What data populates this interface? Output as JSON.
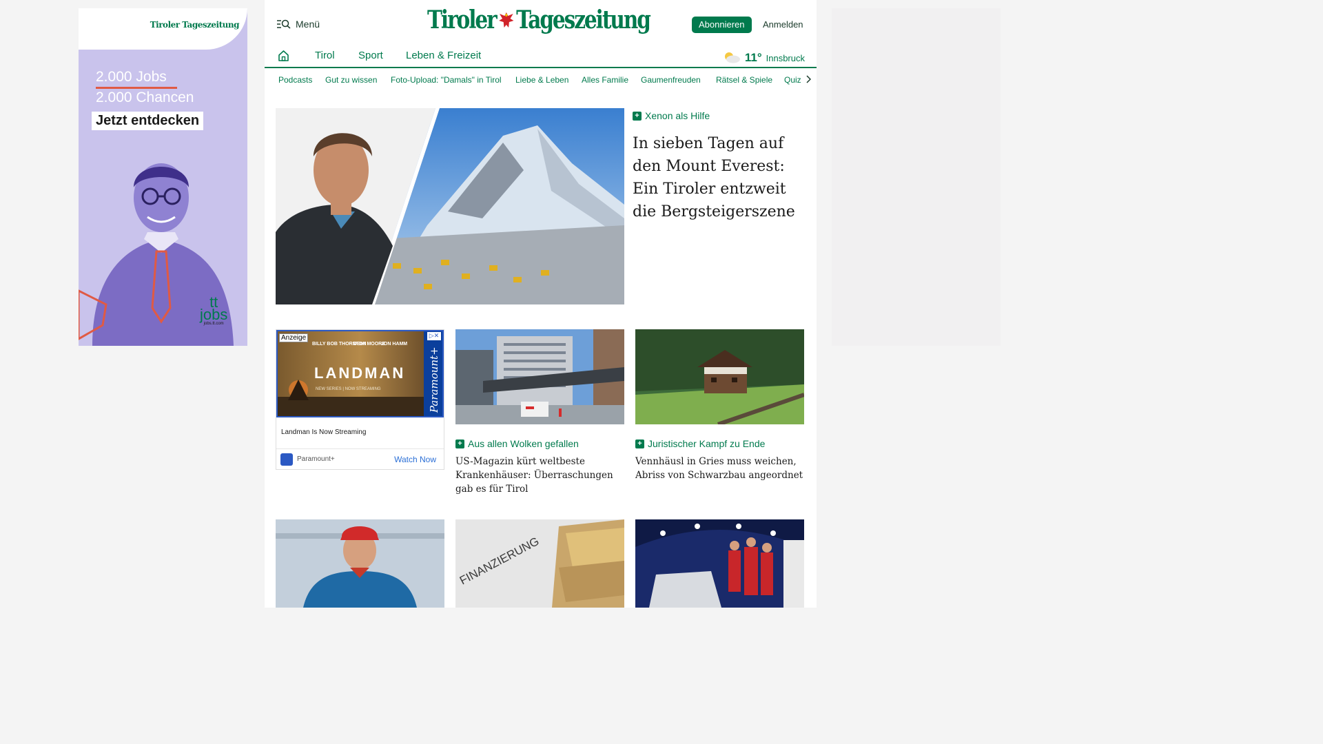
{
  "ad_left": {
    "brand": "Tiroler Tageszeitung",
    "line1": "2.000 Jobs",
    "line2": "2.000 Chancen",
    "cta": "Jetzt entdecken",
    "logo_text": "tt",
    "logo_sub": "jobs",
    "logo_url": "jobs.tt.com"
  },
  "header": {
    "menu_label": "Menü",
    "logo_left": "Tiroler",
    "logo_right": "Tageszeitung",
    "subscribe_label": "Abonnieren",
    "login_label": "Anmelden"
  },
  "nav": {
    "items": [
      "Tirol",
      "Sport",
      "Leben & Freizeit"
    ],
    "weather": {
      "temp": "11°",
      "city": "Innsbruck",
      "icon": "partly-cloudy-icon"
    }
  },
  "subnav": {
    "items": [
      "Podcasts",
      "Gut zu wissen",
      "Foto-Upload: \"Damals\" in Tirol",
      "Liebe & Leben",
      "Alles Familie",
      "Gaumenfreuden",
      "Rätsel & Spiele",
      "Quiz"
    ]
  },
  "hero": {
    "kicker": "Xenon als Hilfe",
    "title": "In sieben Tagen auf den Mount Everest: Ein Tiroler entzweit die Bergsteigerszene"
  },
  "ad_card": {
    "tag": "Anzeige",
    "cast": [
      "BILLY BOB THORNTON",
      "DEMI MOORE",
      "JON HAMM"
    ],
    "show": "LANDMAN",
    "subline": "NEW SERIES | NOW STREAMING",
    "network": "Paramount+",
    "headline": "Landman Is Now Streaming",
    "source": "Paramount+",
    "cta": "Watch Now"
  },
  "cards": [
    {
      "kicker": "Aus allen Wolken gefallen",
      "title": "US-Magazin kürt weltbeste Krankenhäuser: Überraschungen gab es für Tirol"
    },
    {
      "kicker": "Juristischer Kampf zu Ende",
      "title": "Vennhäusl in Gries muss weichen, Abriss von Schwarzbau angeordnet"
    }
  ],
  "bottom": {
    "finance_word": "FINANZIERUNG"
  },
  "colors": {
    "brand_green": "#007a4d",
    "ad_lavender": "#c9c3ec"
  }
}
